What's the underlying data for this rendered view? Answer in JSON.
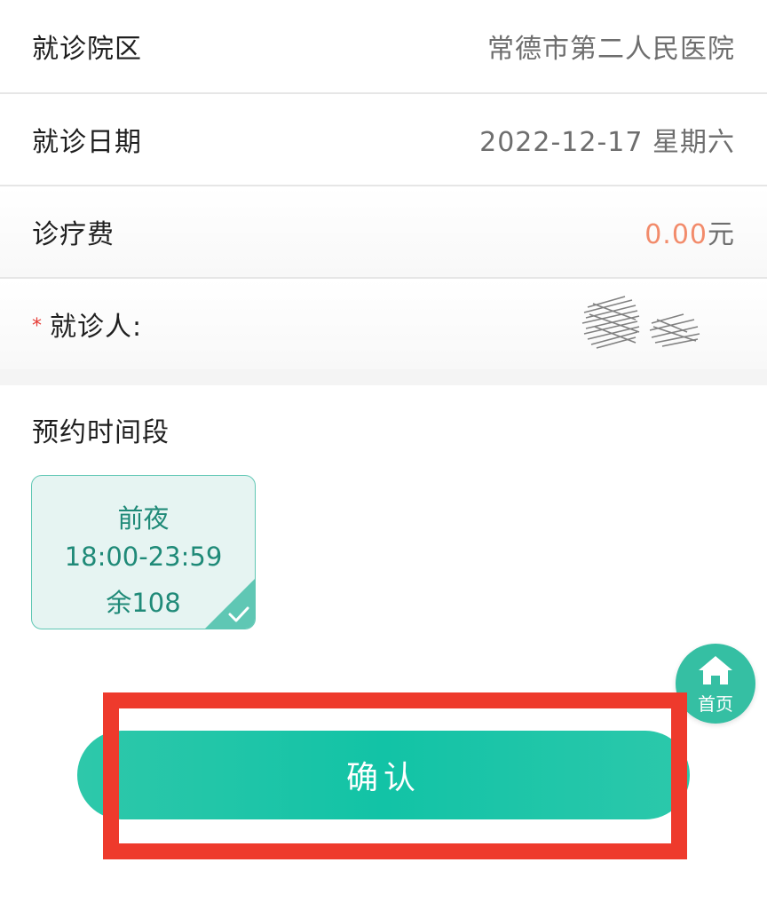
{
  "info": {
    "campus_label": "就诊院区",
    "campus_value": "常德市第二人民医院",
    "date_label": "就诊日期",
    "date_value": "2022-12-17 星期六",
    "fee_label": "诊疗费",
    "fee_amount": "0.00",
    "fee_unit": "元",
    "patient_required_mark": "*",
    "patient_label": "就诊人:"
  },
  "slot_section": {
    "title": "预约时间段",
    "slots": [
      {
        "period": "前夜",
        "time": "18:00-23:59",
        "remaining": "余108",
        "selected": true
      }
    ]
  },
  "home_button": {
    "label": "首页",
    "icon": "home-icon"
  },
  "confirm_button": {
    "label": "确认"
  },
  "colors": {
    "accent": "#1ec3a5",
    "fee": "#f28b6b",
    "required": "#e63b35",
    "highlight": "#ee3a2c"
  }
}
